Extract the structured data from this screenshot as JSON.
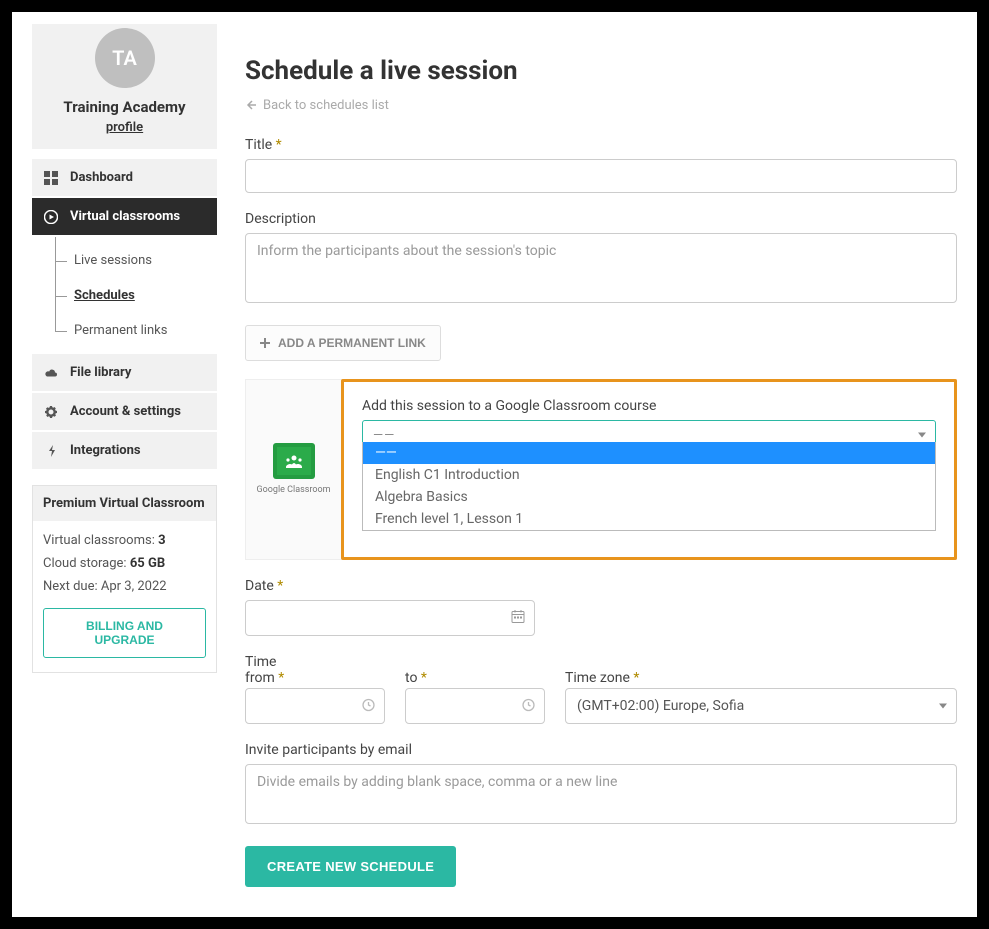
{
  "profile": {
    "avatar_initials": "TA",
    "name": "Training Academy",
    "profile_link": "profile"
  },
  "nav": {
    "dashboard": "Dashboard",
    "virtual_classrooms": "Virtual classrooms",
    "sub": {
      "live_sessions": "Live sessions",
      "schedules": "Schedules",
      "permanent_links": "Permanent links"
    },
    "file_library": "File library",
    "account_settings": "Account & settings",
    "integrations": "Integrations"
  },
  "premium": {
    "heading": "Premium Virtual Classroom",
    "classrooms_label": "Virtual classrooms: ",
    "classrooms_value": "3",
    "storage_label": "Cloud storage: ",
    "storage_value": "65 GB",
    "next_due_label": "Next due: ",
    "next_due_value": "Apr 3, 2022",
    "upgrade_btn": "BILLING AND UPGRADE"
  },
  "page": {
    "title": "Schedule a live session",
    "back_link": "Back to schedules list"
  },
  "form": {
    "title_label": "Title ",
    "description_label": "Description",
    "description_placeholder": "Inform the participants about the session's topic",
    "add_permanent_link": "ADD A PERMANENT LINK",
    "gc_label": "Add this session to a Google Classroom course",
    "gc_caption": "Google Classroom",
    "gc_selected": "——",
    "gc_options": [
      "——",
      "English C1 Introduction",
      "Algebra Basics",
      "French level 1, Lesson 1"
    ],
    "date_label": "Date ",
    "time_label": "Time",
    "from_label": "from ",
    "to_label": "to ",
    "tz_label": "Time zone ",
    "tz_value": "(GMT+02:00) Europe, Sofia",
    "invite_label": "Invite participants by email",
    "invite_placeholder": "Divide emails by adding blank space, comma or a new line",
    "create_btn": "CREATE NEW SCHEDULE"
  }
}
